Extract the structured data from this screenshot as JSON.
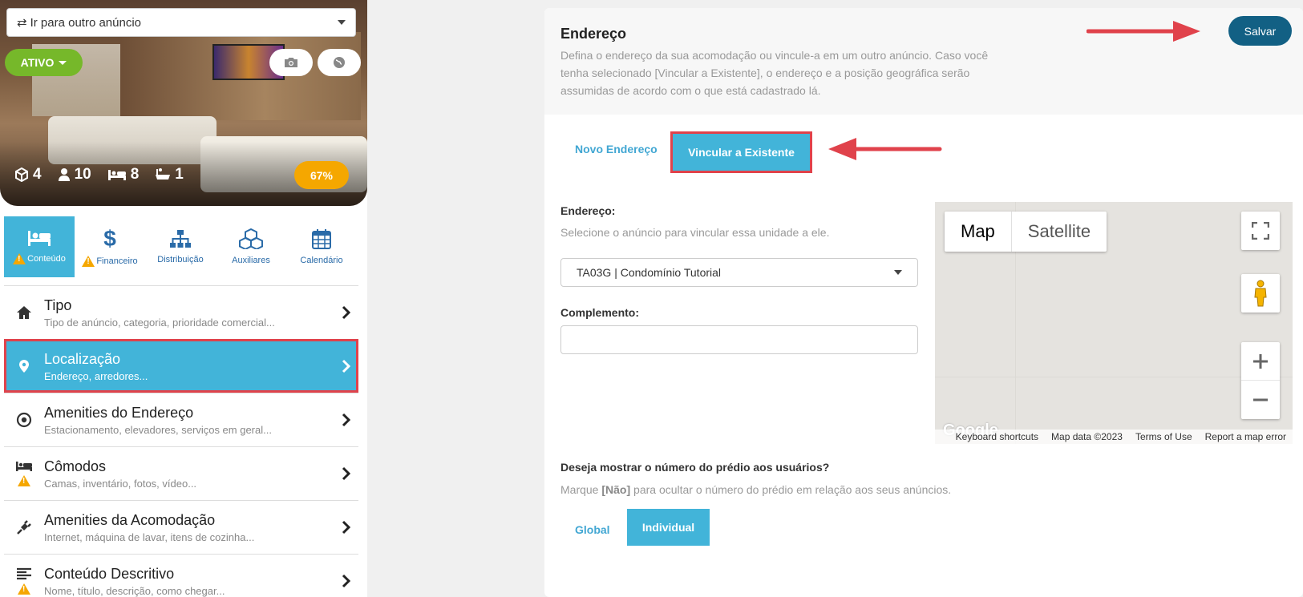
{
  "switcher": {
    "label": "Ir para outro anúncio",
    "icon": "swap-icon"
  },
  "status": {
    "label": "ATIVO"
  },
  "stats": {
    "units": "4",
    "guests": "10",
    "beds": "8",
    "baths": "1"
  },
  "completion": "67%",
  "tabs": [
    {
      "label": "Conteúdo",
      "icon": "bed-icon",
      "warning": true
    },
    {
      "label": "Financeiro",
      "icon": "dollar-icon",
      "warning": true
    },
    {
      "label": "Distribuição",
      "icon": "sitemap-icon",
      "warning": false
    },
    {
      "label": "Auxiliares",
      "icon": "cubes-icon",
      "warning": false
    },
    {
      "label": "Calendário",
      "icon": "calendar-icon",
      "warning": false
    }
  ],
  "menu": [
    {
      "title": "Tipo",
      "subtitle": "Tipo de anúncio, categoria, prioridade comercial...",
      "icon": "home-icon"
    },
    {
      "title": "Localização",
      "subtitle": "Endereço, arredores...",
      "icon": "map-pin-icon"
    },
    {
      "title": "Amenities do Endereço",
      "subtitle": "Estacionamento, elevadores, serviços em geral...",
      "icon": "target-icon"
    },
    {
      "title": "Cômodos",
      "subtitle": "Camas, inventário, fotos, vídeo...",
      "icon": "bed-icon"
    },
    {
      "title": "Amenities da Acomodação",
      "subtitle": "Internet, máquina de lavar, itens de cozinha...",
      "icon": "plug-icon"
    },
    {
      "title": "Conteúdo Descritivo",
      "subtitle": "Nome, título, descrição, como chegar...",
      "icon": "align-left-icon"
    }
  ],
  "header": {
    "title": "Endereço",
    "description": "Defina o endereço da sua acomodação ou vincule-a em um outro anúncio. Caso você tenha selecionado [Vincular a Existente], o endereço e a posição geográfica serão assumidas de acordo com o que está cadastrado lá.",
    "save_label": "Salvar"
  },
  "address_tabs": {
    "new": "Novo Endereço",
    "link": "Vincular a Existente"
  },
  "form": {
    "address_label": "Endereço:",
    "address_help": "Selecione o anúncio para vincular essa unidade a ele.",
    "address_value": "TA03G | Condomínio Tutorial",
    "complement_label": "Complemento:",
    "complement_value": ""
  },
  "map": {
    "type_map": "Map",
    "type_satellite": "Satellite",
    "logo": "Google",
    "footer": [
      "Keyboard shortcuts",
      "Map data ©2023",
      "Terms of Use",
      "Report a map error"
    ]
  },
  "building_number": {
    "question": "Deseja mostrar o número do prédio aos usuários?",
    "help_prefix": "Marque ",
    "help_bold": "[Não]",
    "help_suffix": " para ocultar o número do prédio em relação aos seus anúncios.",
    "tab_global": "Global",
    "tab_individual": "Individual"
  },
  "colors": {
    "accent": "#42b4d9",
    "save": "#126084",
    "active_green": "#76b82a",
    "warning": "#f5a700",
    "highlight": "#e0424b"
  }
}
